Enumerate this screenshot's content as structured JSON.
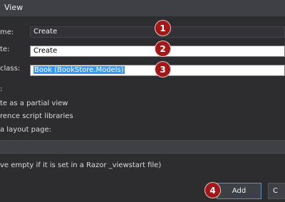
{
  "window": {
    "title": "View"
  },
  "form": {
    "view_name_label": "me:",
    "view_name_value": "Create",
    "template_label": "te:",
    "template_value": "Create",
    "model_class_label": "class:",
    "model_class_value": "Book (BookStore.Models)"
  },
  "options": {
    "section_label": ":",
    "partial_view": "te as a partial view",
    "script_libraries": "rence script libraries",
    "layout_page": "a layout page:",
    "layout_hint": "ve empty if it is set in a Razor _viewstart file)"
  },
  "buttons": {
    "add": "Add",
    "cancel": "C"
  },
  "callouts": [
    "1",
    "2",
    "3",
    "4"
  ],
  "colors": {
    "badge": "#a21818",
    "selection": "#3399ff",
    "focus_border": "#3399ff"
  }
}
